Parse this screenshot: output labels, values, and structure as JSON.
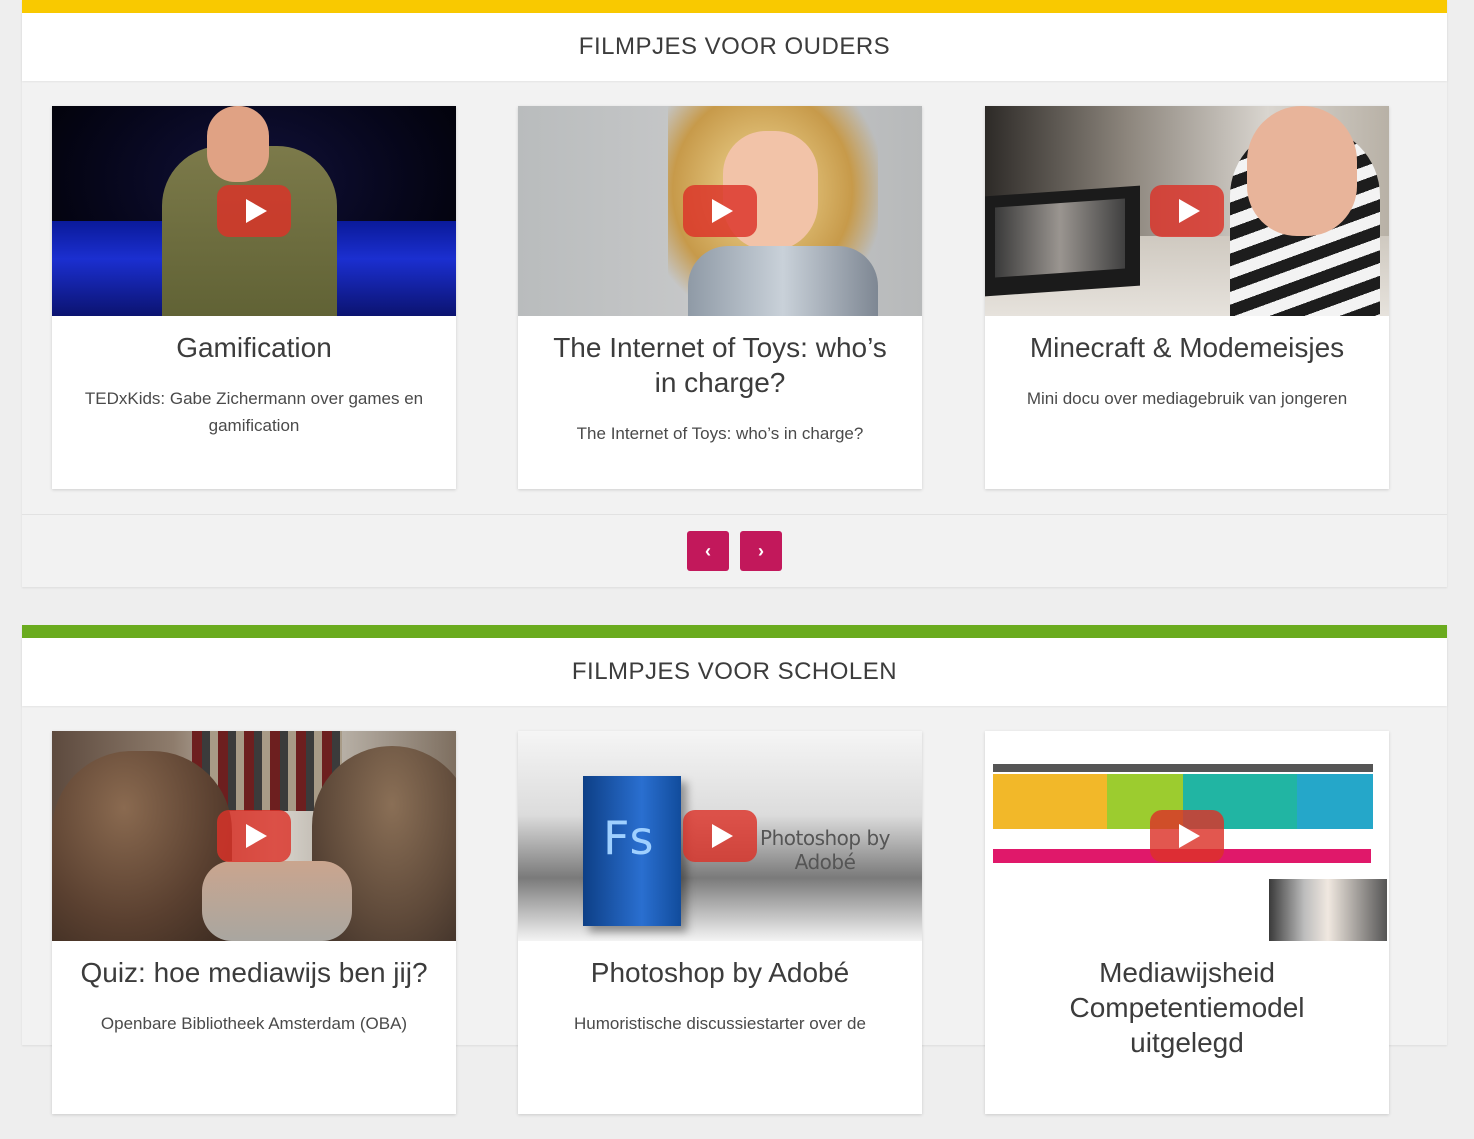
{
  "sections": [
    {
      "title": "FILMPJES VOOR OUDERS",
      "accent_color": "#f9c900",
      "cards": [
        {
          "title": "Gamification",
          "description": "TEDxKids: Gabe Zichermann over games en gamification",
          "thumb_icon": "play-icon"
        },
        {
          "title": "The Internet of Toys: who’s in charge?",
          "description": "The Internet of Toys: who’s in charge?",
          "thumb_icon": "play-icon"
        },
        {
          "title": "Minecraft & Modemeisjes",
          "description": "Mini docu over mediagebruik van jongeren",
          "thumb_icon": "play-icon"
        }
      ],
      "pager": {
        "prev_label": "‹",
        "next_label": "›",
        "button_color": "#c2185b"
      }
    },
    {
      "title": "FILMPJES VOOR SCHOLEN",
      "accent_color": "#6aab1e",
      "cards": [
        {
          "title": "Quiz: hoe mediawijs ben jij?",
          "description": "Openbare Bibliotheek Amsterdam (OBA)",
          "thumb_icon": "play-icon"
        },
        {
          "title": "Photoshop by Adobé",
          "description": "Humoristische discussiestarter over de",
          "thumb_icon": "play-icon",
          "thumb_text": "Photoshop by Adobé",
          "box_text": "Fs"
        },
        {
          "title": "Mediawijsheid Competentiemodel uitgelegd",
          "description": "",
          "thumb_icon": "play-icon"
        }
      ]
    }
  ]
}
